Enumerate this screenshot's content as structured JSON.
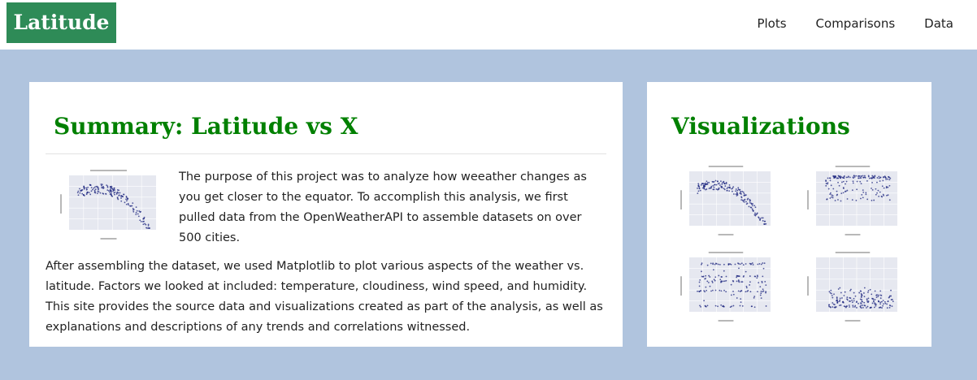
{
  "nav": {
    "brand": "Latitude",
    "links": [
      "Plots",
      "Comparisons",
      "Data"
    ]
  },
  "summary": {
    "title": "Summary: Latitude vs X",
    "paragraphs": [
      "The purpose of this project was to analyze how weeather changes as you get closer to the equator. To accomplish this analysis, we first pulled data from the OpenWeatherAPI to assemble datasets on over 500 cities.",
      "After assembling the dataset, we used Matplotlib to plot various aspects of the weather vs. latitude. Factors we looked at included: temperature, cloudiness, wind speed, and humidity. This site provides the source data and visualizations created as part of the analysis, as well as explanations and descriptions of any trends and correlations witnessed."
    ]
  },
  "visualizations": {
    "title": "Visualizations"
  },
  "colors": {
    "brand_bg": "#2e8b57",
    "heading": "#008000",
    "page_bg": "#b0c4de",
    "plot_bg": "#e6e8f0",
    "marker": "#1a237e"
  }
}
